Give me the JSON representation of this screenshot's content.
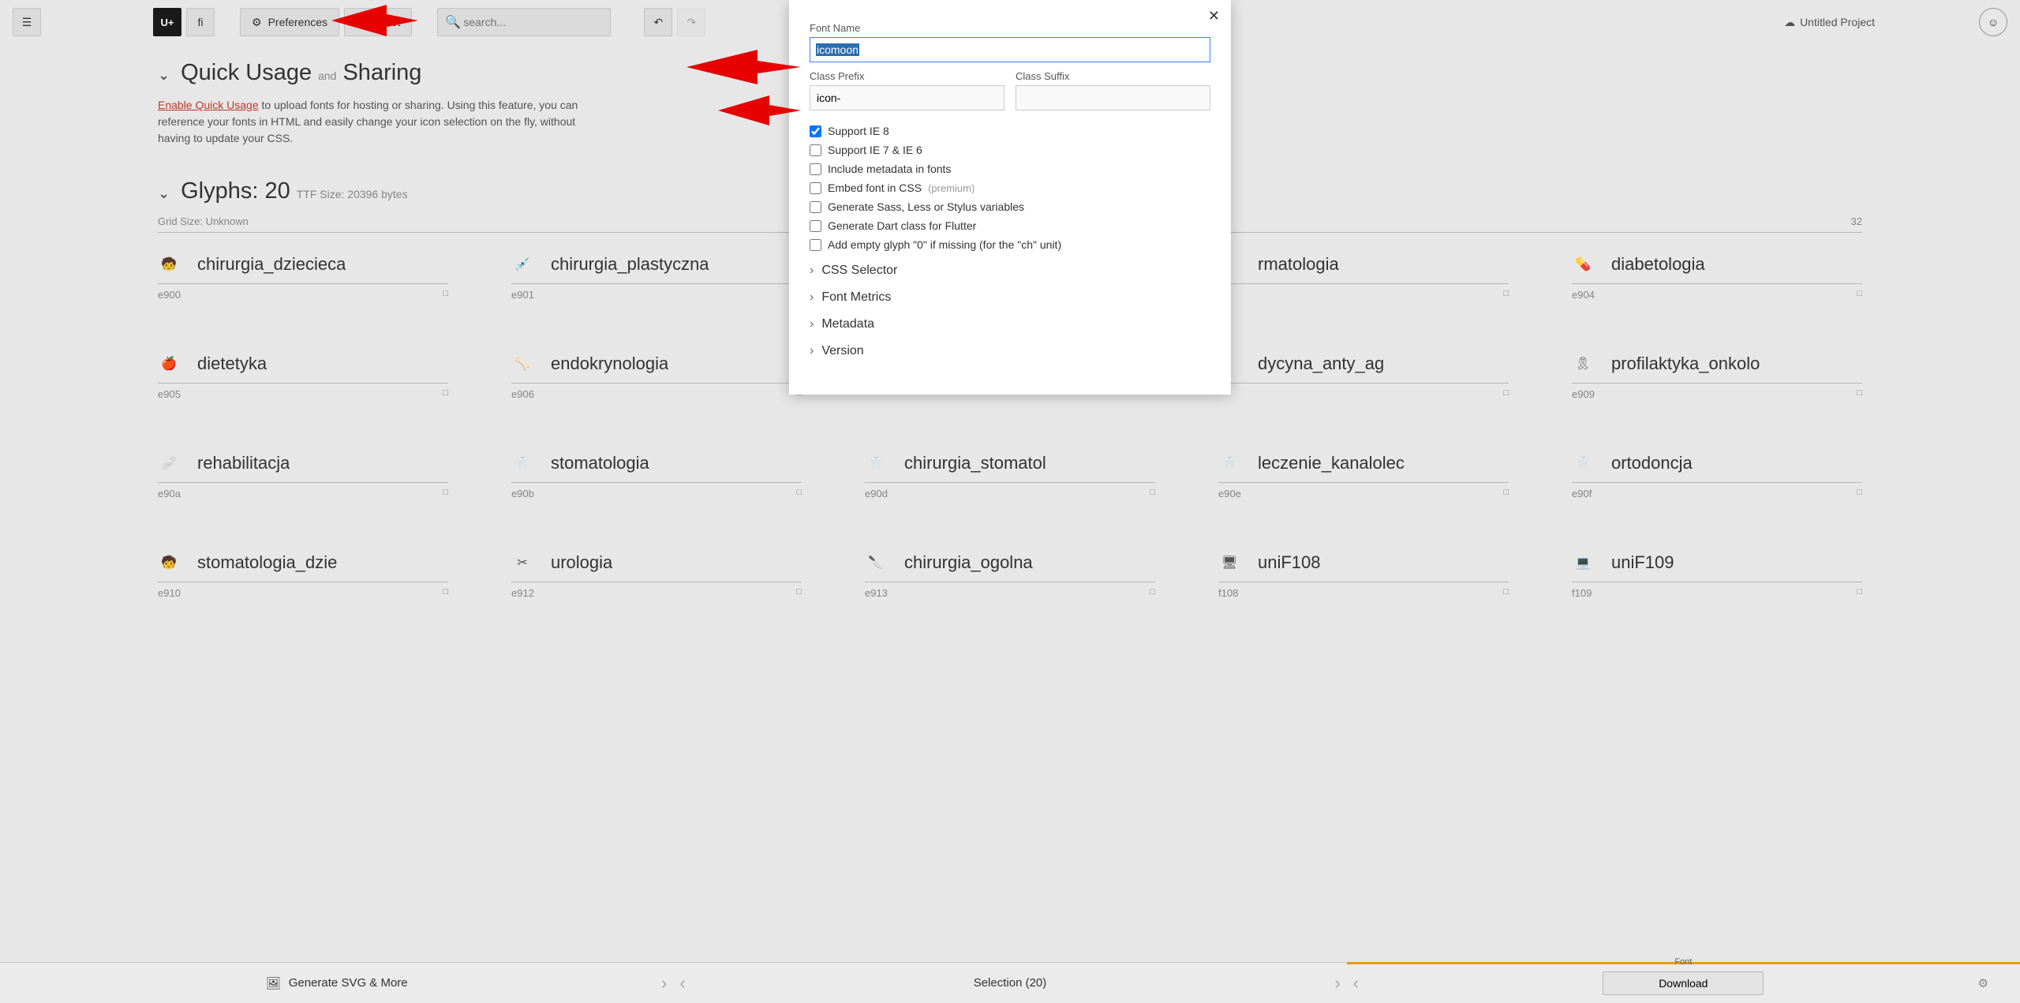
{
  "toolbar": {
    "codepoint_btn": "U+",
    "ligature_btn": "fi",
    "preferences": "Preferences",
    "reset": "Reset",
    "search_placeholder": "search...",
    "project": "Untitled Project"
  },
  "quick_usage": {
    "title": "Quick Usage",
    "and": "and",
    "sharing": "Sharing",
    "link_text": "Enable Quick Usage",
    "para_rest": " to upload fonts for hosting or sharing. Using this feature, you can reference your fonts in HTML and easily change your icon selection on the fly, without having to update your CSS."
  },
  "glyphs_section": {
    "title": "Glyphs: 20",
    "ttf_info": "TTF Size: 20396 bytes",
    "grid_size_label": "Grid Size: Unknown",
    "count_right": "32"
  },
  "glyphs": [
    {
      "name": "chirurgia_dziecieca",
      "code": "e900",
      "u": "□"
    },
    {
      "name": "chirurgia_plastyczna",
      "code": "e901",
      "u": "□"
    },
    {
      "name": "",
      "code": "",
      "u": ""
    },
    {
      "name": "rmatologia",
      "code": "",
      "u": "□"
    },
    {
      "name": "diabetologia",
      "code": "e904",
      "u": "□"
    },
    {
      "name": "dietetyka",
      "code": "e905",
      "u": "□"
    },
    {
      "name": "endokrynologia",
      "code": "e906",
      "u": "□"
    },
    {
      "name": "",
      "code": "",
      "u": ""
    },
    {
      "name": "dycyna_anty_ag",
      "code": "",
      "u": "□"
    },
    {
      "name": "profilaktyka_onkolo",
      "code": "e909",
      "u": "□"
    },
    {
      "name": "rehabilitacja",
      "code": "e90a",
      "u": "□"
    },
    {
      "name": "stomatologia",
      "code": "e90b",
      "u": "□"
    },
    {
      "name": "chirurgia_stomatol",
      "code": "e90d",
      "u": "□"
    },
    {
      "name": "leczenie_kanalolec",
      "code": "e90e",
      "u": "□"
    },
    {
      "name": "ortodoncja",
      "code": "e90f",
      "u": "□"
    },
    {
      "name": "stomatologia_dzie",
      "code": "e910",
      "u": "□"
    },
    {
      "name": "urologia",
      "code": "e912",
      "u": "□"
    },
    {
      "name": "chirurgia_ogolna",
      "code": "e913",
      "u": "□"
    },
    {
      "name": "uniF108",
      "code": "f108",
      "u": "□"
    },
    {
      "name": "uniF109",
      "code": "f109",
      "u": "□"
    }
  ],
  "modal": {
    "font_name_label": "Font Name",
    "font_name_value": "icomoon",
    "class_prefix_label": "Class Prefix",
    "class_prefix_value": "icon-",
    "class_suffix_label": "Class Suffix",
    "class_suffix_value": "",
    "cb_ie8": "Support IE 8",
    "cb_ie76": "Support IE 7 & IE 6",
    "cb_meta": "Include metadata in fonts",
    "cb_embed": "Embed font in CSS",
    "cb_embed_prem": "(premium)",
    "cb_sass": "Generate Sass, Less or Stylus variables",
    "cb_dart": "Generate Dart class for Flutter",
    "cb_empty": "Add empty glyph \"0\" if missing (for the \"ch\" unit)",
    "exp_css": "CSS Selector",
    "exp_metrics": "Font Metrics",
    "exp_meta": "Metadata",
    "exp_version": "Version"
  },
  "bottom": {
    "svg": "Generate SVG & More",
    "selection": "Selection (20)",
    "font_label": "Font",
    "download": "Download"
  }
}
